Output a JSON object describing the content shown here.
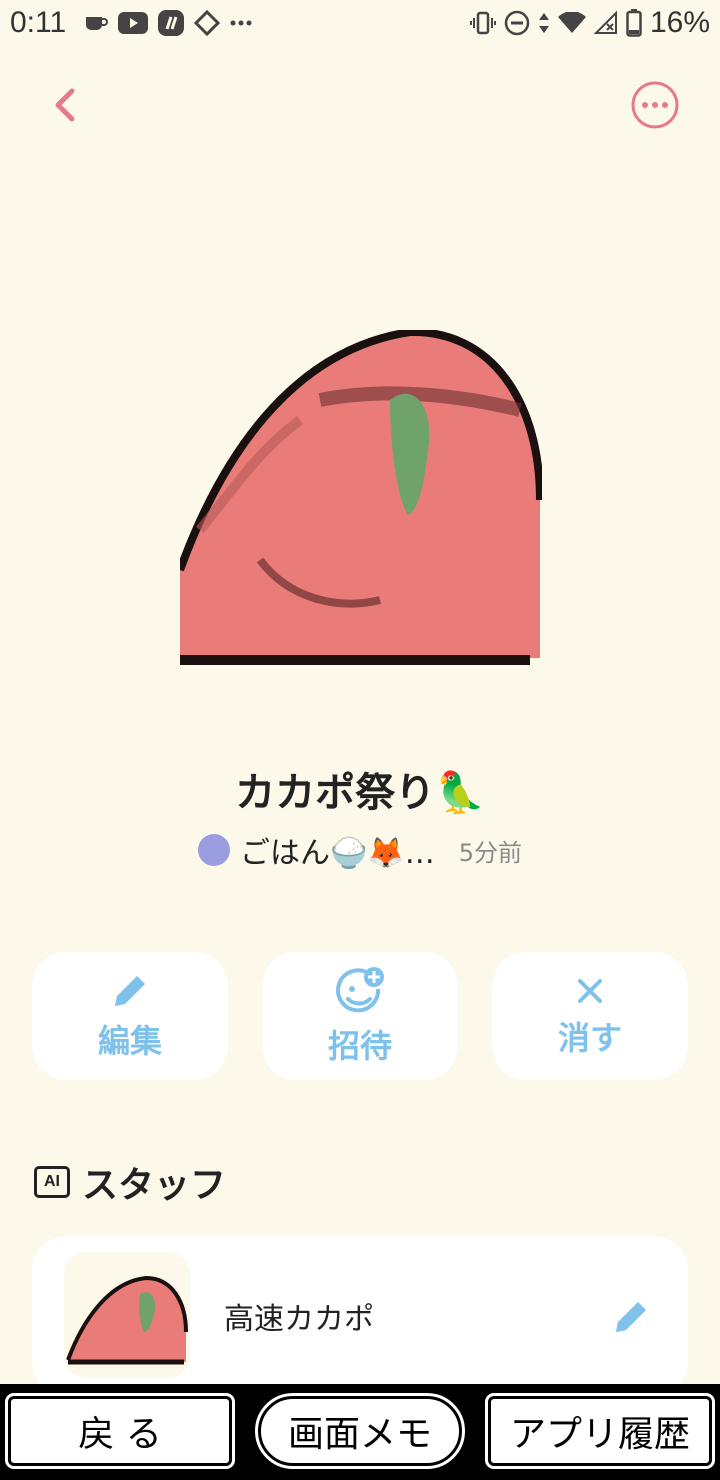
{
  "status_bar": {
    "time": "0:11",
    "battery": "16%",
    "left_icons": [
      "coffee-icon",
      "youtube-icon",
      "app-icon",
      "diamond-icon",
      "more-icon"
    ],
    "right_icons": [
      "vibrate-icon",
      "dnd-icon",
      "data-icon",
      "wifi-icon",
      "no-signal-icon",
      "battery-icon"
    ]
  },
  "header": {
    "back_icon": "chevron-left-icon",
    "more_icon": "ellipsis-circle-icon"
  },
  "room": {
    "title": "カカポ祭り🦜",
    "author": "ごはん🍚🦊…",
    "time_ago": "5分前",
    "author_color": "#9a9ee0"
  },
  "actions": [
    {
      "label": "編集",
      "icon": "pencil-icon"
    },
    {
      "label": "招待",
      "icon": "invite-icon"
    },
    {
      "label": "消す",
      "icon": "close-icon"
    }
  ],
  "staff_section": {
    "badge": "AI",
    "title": "スタッフ",
    "items": [
      {
        "name": "高速カカポ",
        "icon": "pencil-icon"
      }
    ]
  },
  "nav_bar": {
    "back": "戻 る",
    "memo": "画面メモ",
    "history": "アプリ履歴"
  },
  "colors": {
    "background": "#fdf9ea",
    "accent_pink": "#e57a8c",
    "accent_blue": "#7ec2ec"
  }
}
